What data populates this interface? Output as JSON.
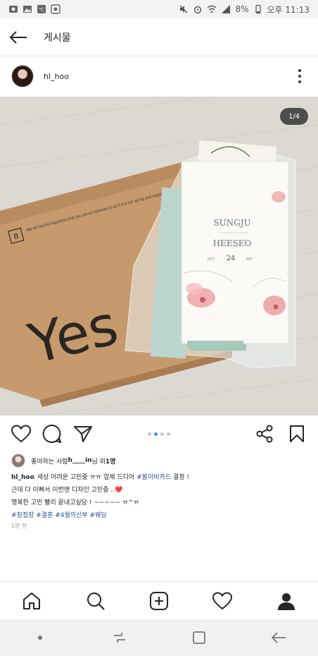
{
  "status_bar": {
    "battery": "8%",
    "time": "오후 11:13",
    "icons": [
      "app-icon",
      "image-icon",
      "weather-icon",
      "settings-icon",
      "mute-icon",
      "alarm-icon",
      "wifi-icon",
      "signal-icon",
      "battery-icon"
    ]
  },
  "header": {
    "title": "게시물",
    "back_icon": "back-arrow-icon"
  },
  "post": {
    "username": "hl_hoo",
    "image_counter": "1/4",
    "photo_box_text": "Yes",
    "photo_box_brand": "B",
    "photo_box_slogan": "We will be the happiness that you are accustomed to as if it is our spring and happiness.",
    "card_names": [
      "SUNGJU",
      "HEESEO"
    ],
    "card_date": {
      "month": "OCT",
      "day": "24",
      "weekday": "SAT"
    },
    "carousel": {
      "count": 4,
      "active": 1
    }
  },
  "likes": {
    "prefix": "좋아하는 사람 ",
    "user": "h____in",
    "suffix": "님 외 ",
    "count": "1명"
  },
  "caption": {
    "username": "hl_hoo",
    "line1_text": "세상 어려운 고민중 ㅠㅠ 업체 드디어 ",
    "line1_tag": "#봄이비카드",
    "line1_end": " 결정 !",
    "line2_text": "근데 다 이뻐서 이번엔 디자인 고민중 ..",
    "line2_heart": "❤️",
    "line3": "행복한 고민 빨리 끝내고싶당 ! ~~~~~ ㅠ^ㅠ",
    "tags": [
      "#청첩장",
      "#결혼",
      "#4월의신부",
      "#웨딩"
    ]
  },
  "timestamp": "1분 전",
  "colors": {
    "accent": "#3897f0",
    "tag": "#1f4e8c",
    "heart": "#d0283a"
  }
}
